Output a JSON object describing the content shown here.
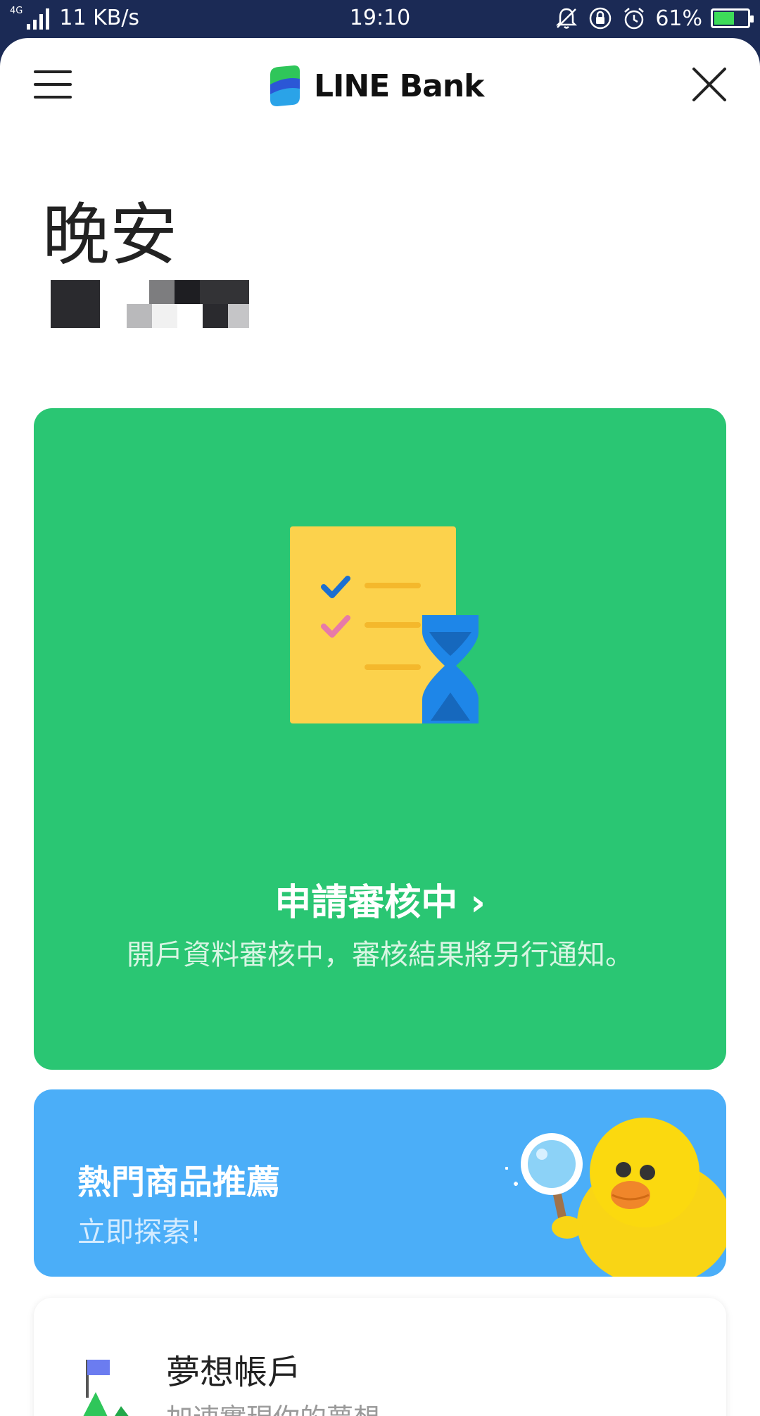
{
  "status_bar": {
    "network": "4G",
    "speed": "11 KB/s",
    "time": "19:10",
    "battery_percent": "61%",
    "battery_level": 0.61
  },
  "header": {
    "logo_text": "LINE Bank"
  },
  "greeting": {
    "text": "晚安"
  },
  "status_card": {
    "title": "申請審核中 ›",
    "subtitle": "開戶資料審核中，審核結果將另行通知。",
    "background": "#2ac673"
  },
  "promo_card": {
    "title": "熱門商品推薦",
    "subtitle": "立即探索!",
    "background": "#4baef8"
  },
  "account_card": {
    "title": "夢想帳戶",
    "subtitle": "加速實現你的夢想"
  },
  "icons": {
    "menu": "hamburger-menu-icon",
    "close": "close-icon",
    "illustration": "document-hourglass-icon",
    "promo": "duck-magnifier-icon",
    "account": "mountain-flag-icon"
  }
}
